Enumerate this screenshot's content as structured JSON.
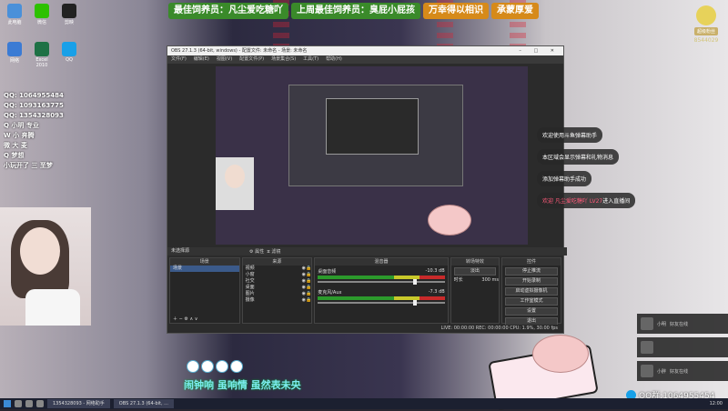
{
  "banner": {
    "items": [
      "最佳饲养员：凡尘爱吃糖吖",
      "上周最佳饲养员：臭屁小屁孩",
      "万幸得以相识",
      "承蒙厚爱"
    ]
  },
  "desktop_icons": [
    {
      "label": "此电脑",
      "color": "#4a90d9"
    },
    {
      "label": "微信",
      "color": "#2dc100"
    },
    {
      "label": "剪映",
      "color": "#222222"
    },
    {
      "label": "网络",
      "color": "#3b7bd4"
    },
    {
      "label": "Excel 2010",
      "color": "#1e7145"
    },
    {
      "label": "QQ",
      "color": "#18a0e8"
    }
  ],
  "qq_list": [
    "QQ: 1064955484",
    "QQ: 1093163775",
    "QQ: 1354328093",
    "Q 小明 专业",
    "W 小 奔腾",
    "微 大 麦",
    "Q 梦想",
    "小玩开了 三 至梦"
  ],
  "obs": {
    "title": "OBS 27.1.3 (64-bit, windows) - 配置文件: 未命名 - 场景: 未命名",
    "menu": [
      "文件(F)",
      "编辑(E)",
      "视图(V)",
      "配置文件(P)",
      "场景集合(S)",
      "工具(T)",
      "帮助(H)"
    ],
    "scene_label": "未选择源",
    "toolbar_props": "属性",
    "toolbar_filters": "滤镜",
    "docks": {
      "scenes": {
        "title": "场景",
        "items": [
          "场景"
        ]
      },
      "sources": {
        "title": "来源",
        "items": [
          "视频",
          "小窗",
          "社交",
          "桌面",
          "图片",
          "摄像"
        ]
      },
      "mixer": {
        "title": "混音器",
        "channels": [
          {
            "name": "桌面音频",
            "db": "-10.3 dB"
          },
          {
            "name": "麦克风/Aux",
            "db": "-7.3 dB"
          }
        ]
      },
      "transitions": {
        "title": "转场特效",
        "type": "淡出",
        "duration_label": "时长",
        "duration": "300 ms"
      },
      "controls": {
        "title": "控件",
        "buttons": [
          "停止推流",
          "开始录制",
          "启动虚拟摄像机",
          "工作室模式",
          "设置",
          "退出"
        ]
      }
    },
    "status": "LIVE: 00:00:00   REC: 00:00:00   CPU: 1.9%, 30.00 fps"
  },
  "chat": [
    {
      "text": "欢迎使用斗鱼弹幕助手",
      "highlight": ""
    },
    {
      "text": "本区域会显示弹幕和礼物消息",
      "highlight": ""
    },
    {
      "text": "添加弹幕助手成功",
      "highlight": ""
    },
    {
      "text": "进入直播间",
      "highlight": "欢迎 凡尘爱吃糖吖 LV27"
    }
  ],
  "right_panel": {
    "tag": "超级粉丝",
    "number": "8544029"
  },
  "messages": [
    {
      "name": "小明",
      "text": "好友在线"
    },
    {
      "name": "",
      "text": ""
    },
    {
      "name": "小胖",
      "text": "好友在线"
    }
  ],
  "qq_badge": "QQ群:1064955454",
  "lyrics": "闹钟响   虽响情   虽然表未央",
  "taskbar": {
    "tasks": [
      "1354328093 - 网络助手",
      "OBS 27.1.3 (64-bit, ..."
    ],
    "clock": "12:00"
  }
}
